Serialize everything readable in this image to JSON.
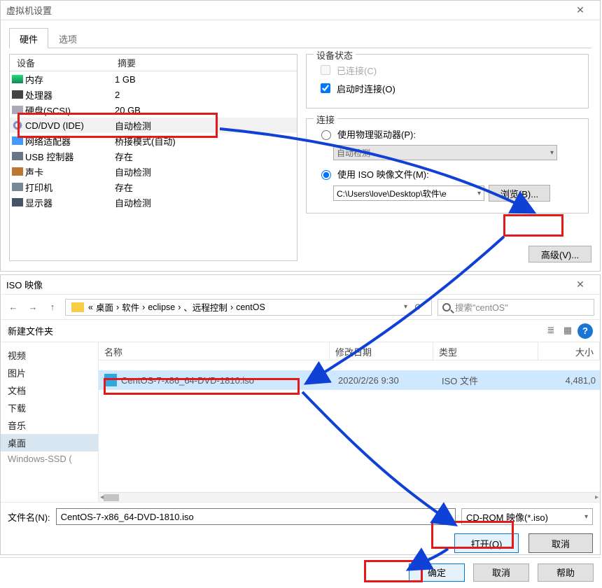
{
  "vm": {
    "title": "虚拟机设置",
    "tabs": {
      "hardware": "硬件",
      "options": "选项"
    },
    "columns": {
      "device": "设备",
      "summary": "摘要"
    },
    "rows": [
      {
        "name": "内存",
        "summary": "1 GB",
        "icon": "mem"
      },
      {
        "name": "处理器",
        "summary": "2",
        "icon": "cpu"
      },
      {
        "name": "硬盘(SCSI)",
        "summary": "20 GB",
        "icon": "hdd"
      },
      {
        "name": "CD/DVD (IDE)",
        "summary": "自动检测",
        "icon": "cd"
      },
      {
        "name": "网络适配器",
        "summary": "桥接模式(自动)",
        "icon": "net"
      },
      {
        "name": "USB 控制器",
        "summary": "存在",
        "icon": "usb"
      },
      {
        "name": "声卡",
        "summary": "自动检测",
        "icon": "snd"
      },
      {
        "name": "打印机",
        "summary": "存在",
        "icon": "prn"
      },
      {
        "name": "显示器",
        "summary": "自动检测",
        "icon": "dsp"
      }
    ],
    "group_status": "设备状态",
    "connected": "已连接(C)",
    "connect_poweron": "启动时连接(O)",
    "group_conn": "连接",
    "use_physical": "使用物理驱动器(P):",
    "auto_detect": "自动检测",
    "use_iso": "使用 ISO 映像文件(M):",
    "iso_path": "C:\\Users\\love\\Desktop\\软件\\e",
    "browse": "浏览(B)...",
    "advanced": "高级(V)..."
  },
  "open": {
    "title": "ISO 映像",
    "breadcrumb": {
      "prefix": "«",
      "b1": "桌面",
      "b2": "软件",
      "b3": "eclipse",
      "b4": "、远程控制",
      "b5": "centOS",
      "sep": "›"
    },
    "search_placeholder": "搜索\"centOS\"",
    "new_folder": "新建文件夹",
    "nav": {
      "video": "视频",
      "pictures": "图片",
      "docs": "文档",
      "downloads": "下载",
      "music": "音乐",
      "desktop": "桌面",
      "ssd": "Windows-SSD ("
    },
    "cols": {
      "name": "名称",
      "date": "修改日期",
      "type": "类型",
      "size": "大小"
    },
    "file": {
      "name": "CentOS-7-x86_64-DVD-1810.iso",
      "date": "2020/2/26 9:30",
      "type": "ISO 文件",
      "size": "4,481,0"
    },
    "filename_label": "文件名(N):",
    "filename_value": "CentOS-7-x86_64-DVD-1810.iso",
    "filter": "CD-ROM 映像(*.iso)",
    "open_btn": "打开(O)",
    "cancel_btn": "取消"
  },
  "final": {
    "ok": "确定",
    "cancel": "取消",
    "help": "帮助"
  }
}
